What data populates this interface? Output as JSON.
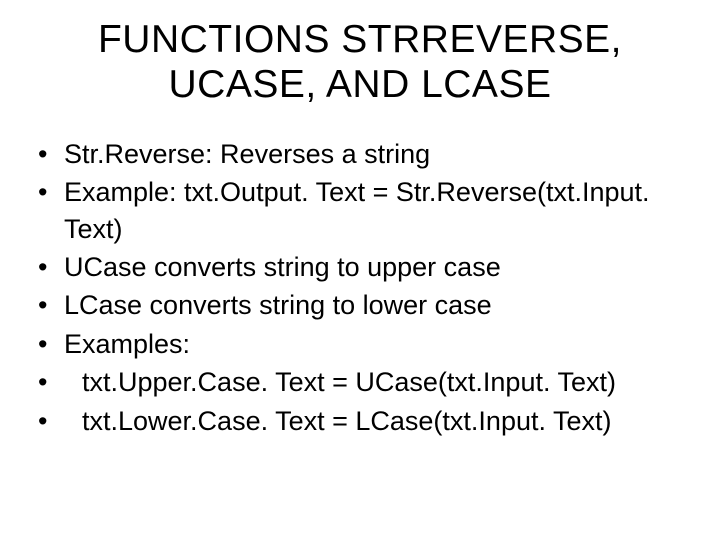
{
  "title": "FUNCTIONS STRREVERSE, UCASE, AND LCASE",
  "bullets": [
    {
      "text": "Str.Reverse: Reverses a string",
      "indent": false
    },
    {
      "text": "Example: txt.Output. Text = Str.Reverse(txt.Input. Text)",
      "indent": false
    },
    {
      "text": "UCase  converts string to upper case",
      "indent": false
    },
    {
      "text": "LCase  converts string to lower case",
      "indent": false
    },
    {
      "text": "Examples:",
      "indent": false
    },
    {
      "text": "txt.Upper.Case. Text = UCase(txt.Input. Text)",
      "indent": true
    },
    {
      "text": "txt.Lower.Case. Text = LCase(txt.Input. Text)",
      "indent": true
    }
  ]
}
